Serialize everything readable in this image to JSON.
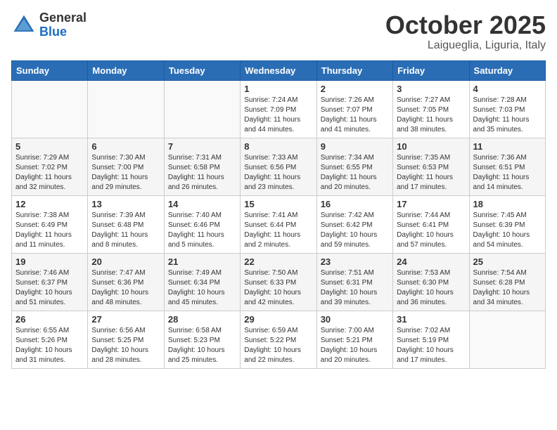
{
  "logo": {
    "general": "General",
    "blue": "Blue"
  },
  "title": "October 2025",
  "location": "Laigueglia, Liguria, Italy",
  "days_of_week": [
    "Sunday",
    "Monday",
    "Tuesday",
    "Wednesday",
    "Thursday",
    "Friday",
    "Saturday"
  ],
  "weeks": [
    [
      {
        "num": "",
        "info": ""
      },
      {
        "num": "",
        "info": ""
      },
      {
        "num": "",
        "info": ""
      },
      {
        "num": "1",
        "info": "Sunrise: 7:24 AM\nSunset: 7:09 PM\nDaylight: 11 hours and 44 minutes."
      },
      {
        "num": "2",
        "info": "Sunrise: 7:26 AM\nSunset: 7:07 PM\nDaylight: 11 hours and 41 minutes."
      },
      {
        "num": "3",
        "info": "Sunrise: 7:27 AM\nSunset: 7:05 PM\nDaylight: 11 hours and 38 minutes."
      },
      {
        "num": "4",
        "info": "Sunrise: 7:28 AM\nSunset: 7:03 PM\nDaylight: 11 hours and 35 minutes."
      }
    ],
    [
      {
        "num": "5",
        "info": "Sunrise: 7:29 AM\nSunset: 7:02 PM\nDaylight: 11 hours and 32 minutes."
      },
      {
        "num": "6",
        "info": "Sunrise: 7:30 AM\nSunset: 7:00 PM\nDaylight: 11 hours and 29 minutes."
      },
      {
        "num": "7",
        "info": "Sunrise: 7:31 AM\nSunset: 6:58 PM\nDaylight: 11 hours and 26 minutes."
      },
      {
        "num": "8",
        "info": "Sunrise: 7:33 AM\nSunset: 6:56 PM\nDaylight: 11 hours and 23 minutes."
      },
      {
        "num": "9",
        "info": "Sunrise: 7:34 AM\nSunset: 6:55 PM\nDaylight: 11 hours and 20 minutes."
      },
      {
        "num": "10",
        "info": "Sunrise: 7:35 AM\nSunset: 6:53 PM\nDaylight: 11 hours and 17 minutes."
      },
      {
        "num": "11",
        "info": "Sunrise: 7:36 AM\nSunset: 6:51 PM\nDaylight: 11 hours and 14 minutes."
      }
    ],
    [
      {
        "num": "12",
        "info": "Sunrise: 7:38 AM\nSunset: 6:49 PM\nDaylight: 11 hours and 11 minutes."
      },
      {
        "num": "13",
        "info": "Sunrise: 7:39 AM\nSunset: 6:48 PM\nDaylight: 11 hours and 8 minutes."
      },
      {
        "num": "14",
        "info": "Sunrise: 7:40 AM\nSunset: 6:46 PM\nDaylight: 11 hours and 5 minutes."
      },
      {
        "num": "15",
        "info": "Sunrise: 7:41 AM\nSunset: 6:44 PM\nDaylight: 11 hours and 2 minutes."
      },
      {
        "num": "16",
        "info": "Sunrise: 7:42 AM\nSunset: 6:42 PM\nDaylight: 10 hours and 59 minutes."
      },
      {
        "num": "17",
        "info": "Sunrise: 7:44 AM\nSunset: 6:41 PM\nDaylight: 10 hours and 57 minutes."
      },
      {
        "num": "18",
        "info": "Sunrise: 7:45 AM\nSunset: 6:39 PM\nDaylight: 10 hours and 54 minutes."
      }
    ],
    [
      {
        "num": "19",
        "info": "Sunrise: 7:46 AM\nSunset: 6:37 PM\nDaylight: 10 hours and 51 minutes."
      },
      {
        "num": "20",
        "info": "Sunrise: 7:47 AM\nSunset: 6:36 PM\nDaylight: 10 hours and 48 minutes."
      },
      {
        "num": "21",
        "info": "Sunrise: 7:49 AM\nSunset: 6:34 PM\nDaylight: 10 hours and 45 minutes."
      },
      {
        "num": "22",
        "info": "Sunrise: 7:50 AM\nSunset: 6:33 PM\nDaylight: 10 hours and 42 minutes."
      },
      {
        "num": "23",
        "info": "Sunrise: 7:51 AM\nSunset: 6:31 PM\nDaylight: 10 hours and 39 minutes."
      },
      {
        "num": "24",
        "info": "Sunrise: 7:53 AM\nSunset: 6:30 PM\nDaylight: 10 hours and 36 minutes."
      },
      {
        "num": "25",
        "info": "Sunrise: 7:54 AM\nSunset: 6:28 PM\nDaylight: 10 hours and 34 minutes."
      }
    ],
    [
      {
        "num": "26",
        "info": "Sunrise: 6:55 AM\nSunset: 5:26 PM\nDaylight: 10 hours and 31 minutes."
      },
      {
        "num": "27",
        "info": "Sunrise: 6:56 AM\nSunset: 5:25 PM\nDaylight: 10 hours and 28 minutes."
      },
      {
        "num": "28",
        "info": "Sunrise: 6:58 AM\nSunset: 5:23 PM\nDaylight: 10 hours and 25 minutes."
      },
      {
        "num": "29",
        "info": "Sunrise: 6:59 AM\nSunset: 5:22 PM\nDaylight: 10 hours and 22 minutes."
      },
      {
        "num": "30",
        "info": "Sunrise: 7:00 AM\nSunset: 5:21 PM\nDaylight: 10 hours and 20 minutes."
      },
      {
        "num": "31",
        "info": "Sunrise: 7:02 AM\nSunset: 5:19 PM\nDaylight: 10 hours and 17 minutes."
      },
      {
        "num": "",
        "info": ""
      }
    ]
  ]
}
